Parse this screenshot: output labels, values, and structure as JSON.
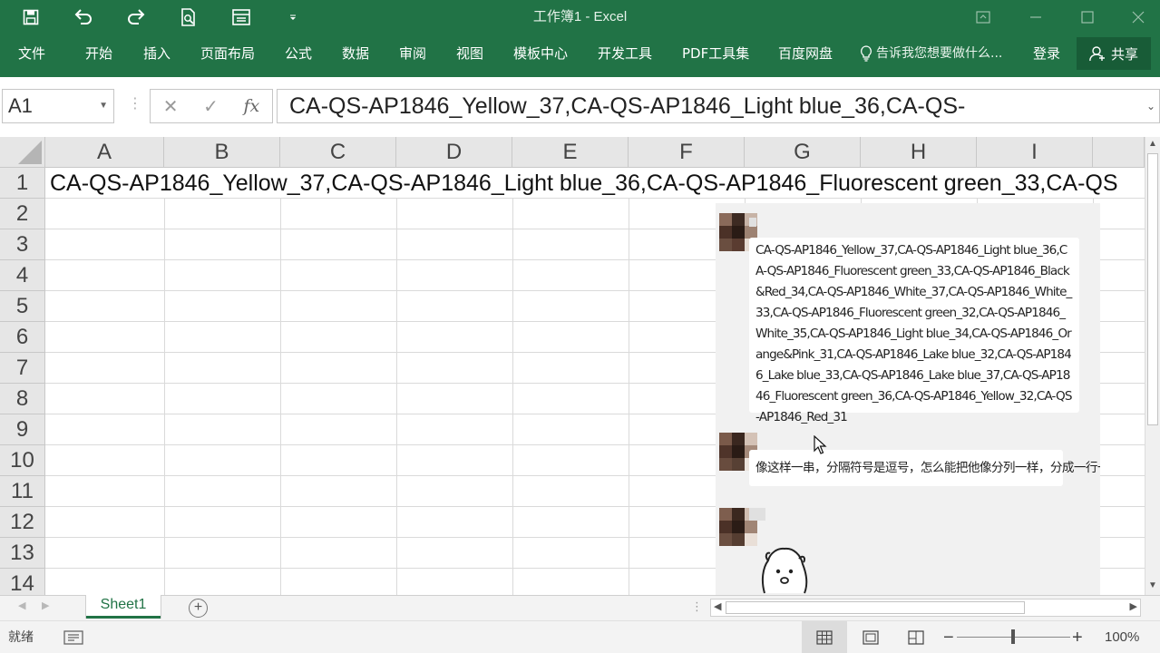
{
  "window": {
    "title": "工作簿1 - Excel",
    "accent_color": "#217346",
    "quick_access": [
      "save-icon",
      "undo-icon",
      "redo-icon",
      "print-preview-icon",
      "form-icon",
      "customize-qat-icon"
    ]
  },
  "ribbon": {
    "tabs": [
      "文件",
      "开始",
      "插入",
      "页面布局",
      "公式",
      "数据",
      "审阅",
      "视图",
      "模板中心",
      "开发工具",
      "PDF工具集",
      "百度网盘"
    ],
    "tell_me": "告诉我您想要做什么...",
    "login": "登录",
    "share": "共享"
  },
  "formula_bar": {
    "name_box": "A1",
    "cancel_symbol": "✕",
    "enter_symbol": "✓",
    "fx_label": "fx",
    "content": "CA-QS-AP1846_Yellow_37,CA-QS-AP1846_Light blue_36,CA-QS-"
  },
  "grid": {
    "columns": [
      "A",
      "B",
      "C",
      "D",
      "E",
      "F",
      "G",
      "H",
      "I"
    ],
    "rows": [
      "1",
      "2",
      "3",
      "4",
      "5",
      "6",
      "7",
      "8",
      "9",
      "10",
      "11",
      "12",
      "13",
      "14"
    ],
    "a1_value": "CA-QS-AP1846_Yellow_37,CA-QS-AP1846_Light blue_36,CA-QS-AP1846_Fluorescent green_33,CA-QS"
  },
  "chat": {
    "message1": "CA-QS-AP1846_Yellow_37,CA-QS-AP1846_Light blue_36,CA-QS-AP1846_Fluorescent green_33,CA-QS-AP1846_Black&Red_34,CA-QS-AP1846_White_37,CA-QS-AP1846_White_33,CA-QS-AP1846_Fluorescent green_32,CA-QS-AP1846_White_35,CA-QS-AP1846_Light blue_34,CA-QS-AP1846_Orange&Pink_31,CA-QS-AP1846_Lake blue_32,CA-QS-AP1846_Lake blue_33,CA-QS-AP1846_Lake blue_37,CA-QS-AP1846_Fluorescent green_36,CA-QS-AP1846_Yellow_32,CA-QS-AP1846_Red_31",
    "message2": "像这样一串，分隔符号是逗号，怎么能把他像分列一样，分成一行一行的"
  },
  "sheets": {
    "tabs": [
      "Sheet1"
    ],
    "active": "Sheet1"
  },
  "status": {
    "ready": "就绪",
    "zoom": "100%"
  }
}
